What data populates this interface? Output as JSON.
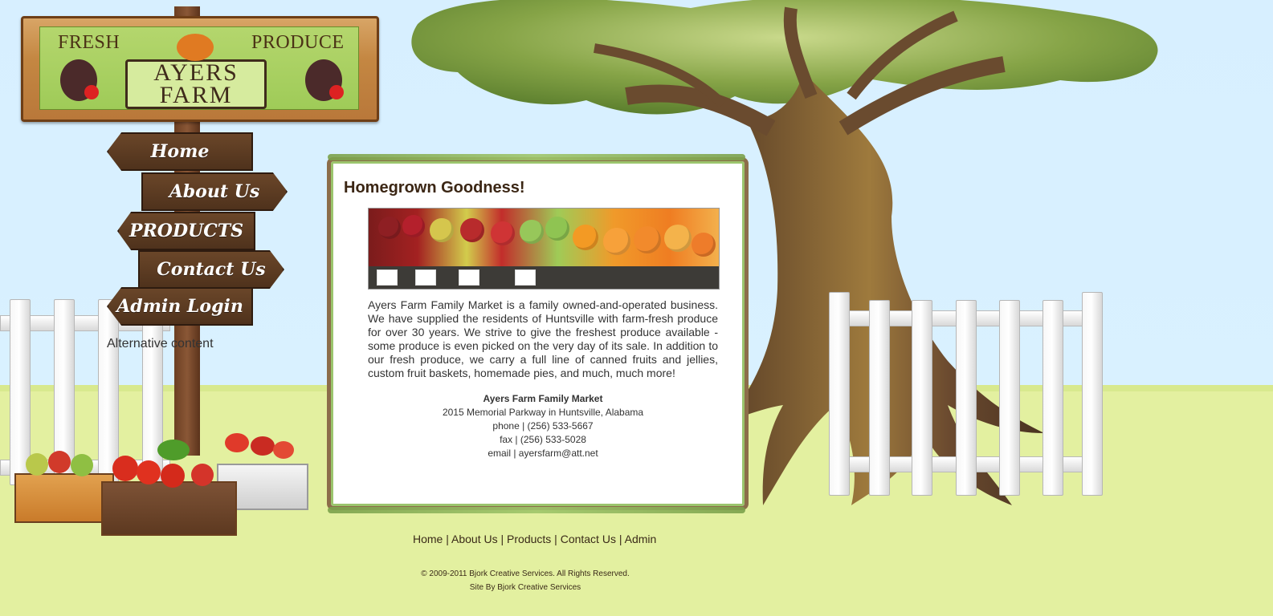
{
  "brand": {
    "logo_top_left": "FRESH",
    "logo_top_right": "PRODUCE",
    "logo_line_1": "AYERS",
    "logo_line_2": "FARM"
  },
  "nav": [
    {
      "label": "Home"
    },
    {
      "label": "About Us"
    },
    {
      "label": "PRODUCTS"
    },
    {
      "label": "Contact Us"
    },
    {
      "label": "Admin Login"
    }
  ],
  "alt_content": "Alternative content",
  "content": {
    "title": "Homegrown Goodness!",
    "paragraph": "Ayers Farm Family Market is a family owned-and-operated business. We have supplied the residents of Huntsville with farm-fresh produce for over 30 years. We strive to give the freshest produce available - some produce is even picked on the very day of its sale. In addition to our fresh produce, we carry a full line of canned fruits and jellies, custom fruit baskets, homemade pies, and much, much more!",
    "address": {
      "name": "Ayers Farm Family Market",
      "street": "2015 Memorial Parkway in Huntsville, Alabama",
      "phone": "phone | (256) 533-5667",
      "fax": "fax | (256) 533-5028",
      "email": "email | ayersfarm@att.net"
    }
  },
  "footer": {
    "links": [
      {
        "label": "Home"
      },
      {
        "label": "About Us"
      },
      {
        "label": "Products"
      },
      {
        "label": "Contact Us"
      },
      {
        "label": "Admin"
      }
    ],
    "separator": " | ",
    "copyright": "© 2009-2011 Bjork Creative Services. All Rights Reserved.",
    "site_by": "Site By Bjork Creative Services"
  }
}
